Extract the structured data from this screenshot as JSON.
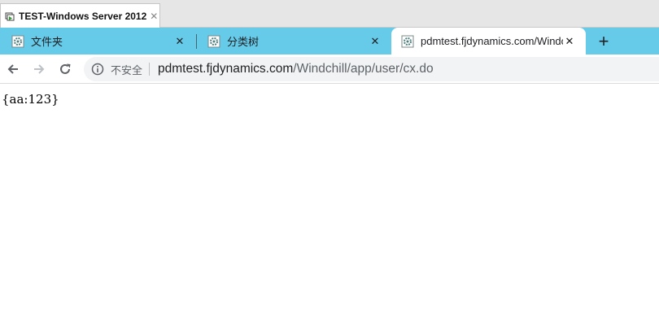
{
  "outer_tab": {
    "title": "TEST-Windows Server 2012",
    "close": "✕"
  },
  "browser_tabs": [
    {
      "title": "文件夹",
      "close": "✕"
    },
    {
      "title": "分类树",
      "close": "✕"
    },
    {
      "title": "pdmtest.fjdynamics.com/Windchill/app/user/cx.do",
      "close": "✕"
    }
  ],
  "new_tab": "+",
  "address_bar": {
    "security_label": "不安全",
    "url_host": "pdmtest.fjdynamics.com",
    "url_path": "/Windchill/app/user/cx.do"
  },
  "page": {
    "body_text": "{aa:123}"
  },
  "colors": {
    "tab_strip": "#66cae9",
    "omnibox": "#f1f3f4"
  }
}
